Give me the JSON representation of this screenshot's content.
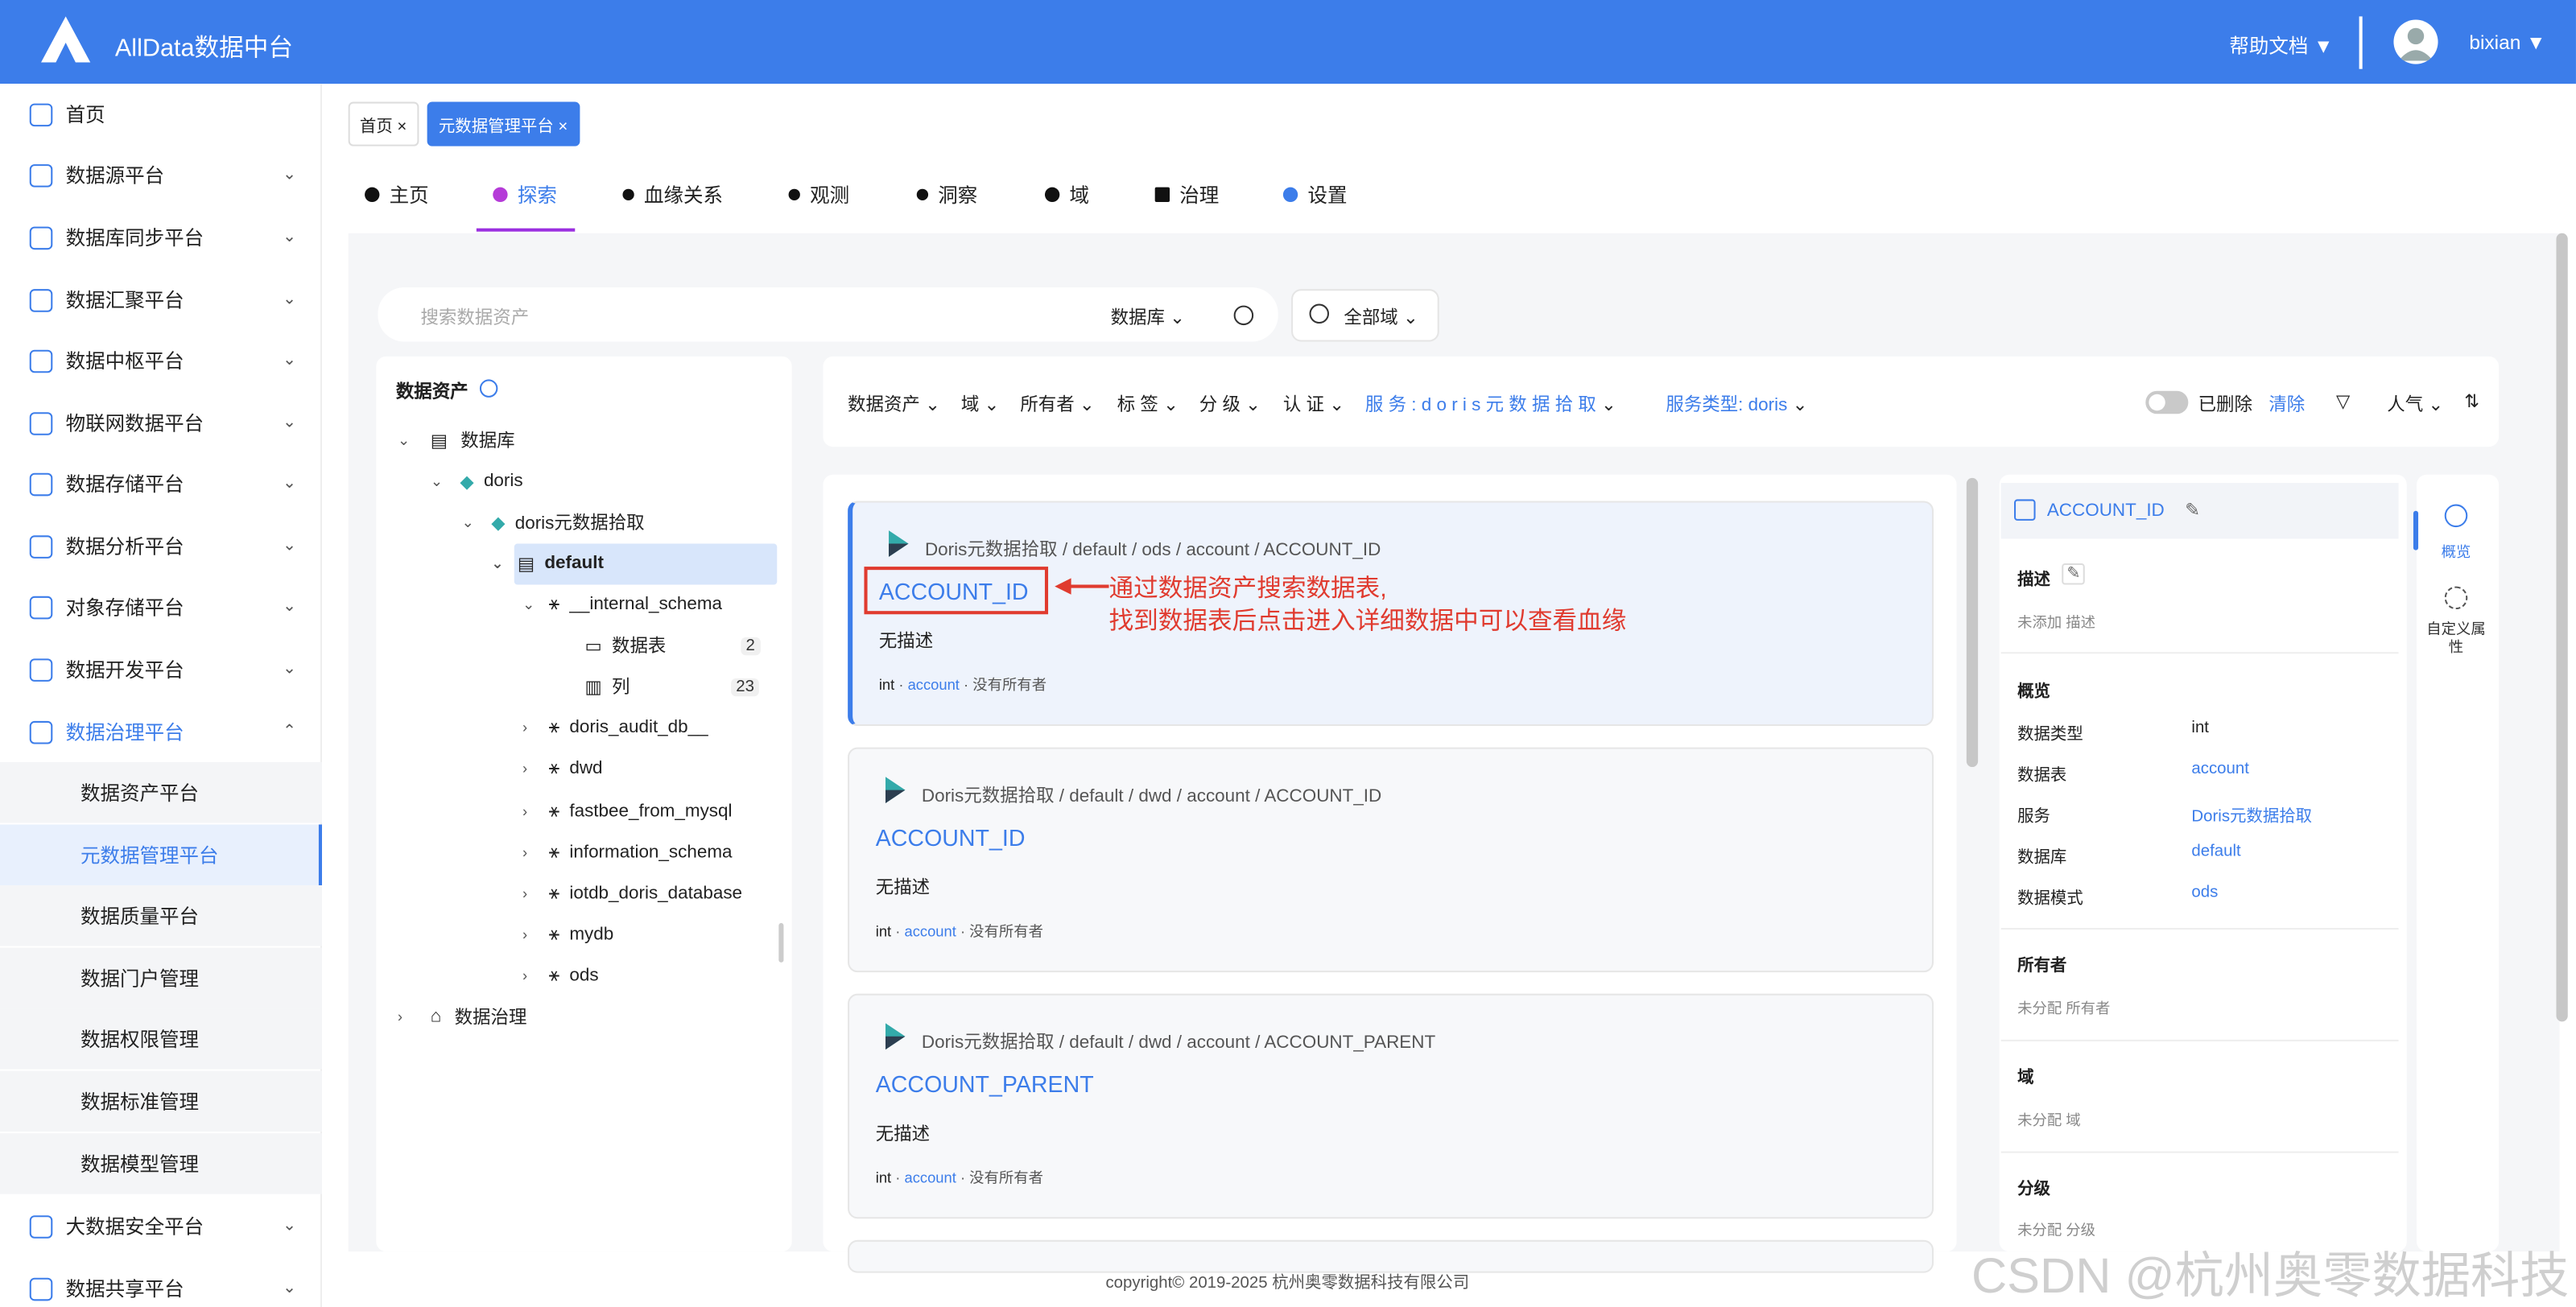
{
  "header": {
    "title": "AllData数据中台",
    "help": "帮助文档 ▼",
    "user": "bixian ▼"
  },
  "sidebar": {
    "items": [
      {
        "label": "首页"
      },
      {
        "label": "数据源平台"
      },
      {
        "label": "数据库同步平台"
      },
      {
        "label": "数据汇聚平台"
      },
      {
        "label": "数据中枢平台"
      },
      {
        "label": "物联网数据平台"
      },
      {
        "label": "数据存储平台"
      },
      {
        "label": "数据分析平台"
      },
      {
        "label": "对象存储平台"
      },
      {
        "label": "数据开发平台"
      },
      {
        "label": "数据治理平台"
      },
      {
        "label": "大数据安全平台"
      },
      {
        "label": "数据共享平台"
      }
    ],
    "sub": [
      {
        "label": "数据资产平台"
      },
      {
        "label": "元数据管理平台"
      },
      {
        "label": "数据质量平台"
      },
      {
        "label": "数据门户管理"
      },
      {
        "label": "数据权限管理"
      },
      {
        "label": "数据标准管理"
      },
      {
        "label": "数据模型管理"
      }
    ]
  },
  "pagetabs": [
    {
      "label": "首页 ×"
    },
    {
      "label": "元数据管理平台 ×"
    }
  ],
  "navtabs": [
    {
      "label": "主页",
      "icon": "home-icon"
    },
    {
      "label": "探索",
      "icon": "explore-icon"
    },
    {
      "label": "血缘关系",
      "icon": "lineage-icon"
    },
    {
      "label": "观测",
      "icon": "observe-icon"
    },
    {
      "label": "洞察",
      "icon": "insight-icon"
    },
    {
      "label": "域",
      "icon": "domain-icon"
    },
    {
      "label": "治理",
      "icon": "govern-icon"
    },
    {
      "label": "设置",
      "icon": "gear-icon"
    }
  ],
  "search": {
    "placeholder": "搜索数据资产",
    "scope": "数据库",
    "domain": "全部域"
  },
  "tree": {
    "title": "数据资产",
    "nodes": [
      "数据库",
      "doris",
      "doris元数据拾取",
      "default",
      "__internal_schema",
      "数据表",
      "列",
      "doris_audit_db__",
      "dwd",
      "fastbee_from_mysql",
      "information_schema",
      "iotdb_doris_database",
      "mydb",
      "ods",
      "数据治理"
    ],
    "counts": {
      "tables": "2",
      "columns": "23"
    }
  },
  "filters": {
    "asset": "数据资产",
    "domain": "域",
    "owner": "所有者",
    "tag": "标 签",
    "tier": "分 级",
    "cert": "认 证",
    "service": "服 务 :  d o r i s 元 数 据 拾 取",
    "service_type": "服务类型: doris",
    "deleted": "已删除",
    "clear": "清除",
    "sort": "人气"
  },
  "results": [
    {
      "crumb": "Doris元数据拾取  /  default  /  ods  /  account  /  ACCOUNT_ID",
      "name": "ACCOUNT_ID",
      "desc": "无描述",
      "type": "int",
      "table": "account",
      "owner": "没有所有者"
    },
    {
      "crumb": "Doris元数据拾取  /  default  /  dwd  /  account  /  ACCOUNT_ID",
      "name": "ACCOUNT_ID",
      "desc": "无描述",
      "type": "int",
      "table": "account",
      "owner": "没有所有者"
    },
    {
      "crumb": "Doris元数据拾取  /  default  /  dwd  /  account  /  ACCOUNT_PARENT",
      "name": "ACCOUNT_PARENT",
      "desc": "无描述",
      "type": "int",
      "table": "account",
      "owner": "没有所有者"
    }
  ],
  "annotation": {
    "line1": "通过数据资产搜索数据表,",
    "line2": "找到数据表后点击进入详细数据中可以查看血缘"
  },
  "detail": {
    "title": "ACCOUNT_ID",
    "desc_label": "描述",
    "desc_value": "未添加 描述",
    "overview_label": "概览",
    "rows": [
      {
        "k": "数据类型",
        "v": "int"
      },
      {
        "k": "数据表",
        "v": "account"
      },
      {
        "k": "服务",
        "v": "Doris元数据拾取"
      },
      {
        "k": "数据库",
        "v": "default"
      },
      {
        "k": "数据模式",
        "v": "ods"
      }
    ],
    "owner_label": "所有者",
    "owner_value": "未分配 所有者",
    "domain_label": "域",
    "domain_value": "未分配 域",
    "tier_label": "分级",
    "tier_value": "未分配 分级"
  },
  "rail": {
    "overview": "概览",
    "custom": "自定义属性"
  },
  "footer": "copyright© 2019-2025 杭州奥零数据科技有限公司",
  "watermark": "CSDN @杭州奥零数据科技"
}
